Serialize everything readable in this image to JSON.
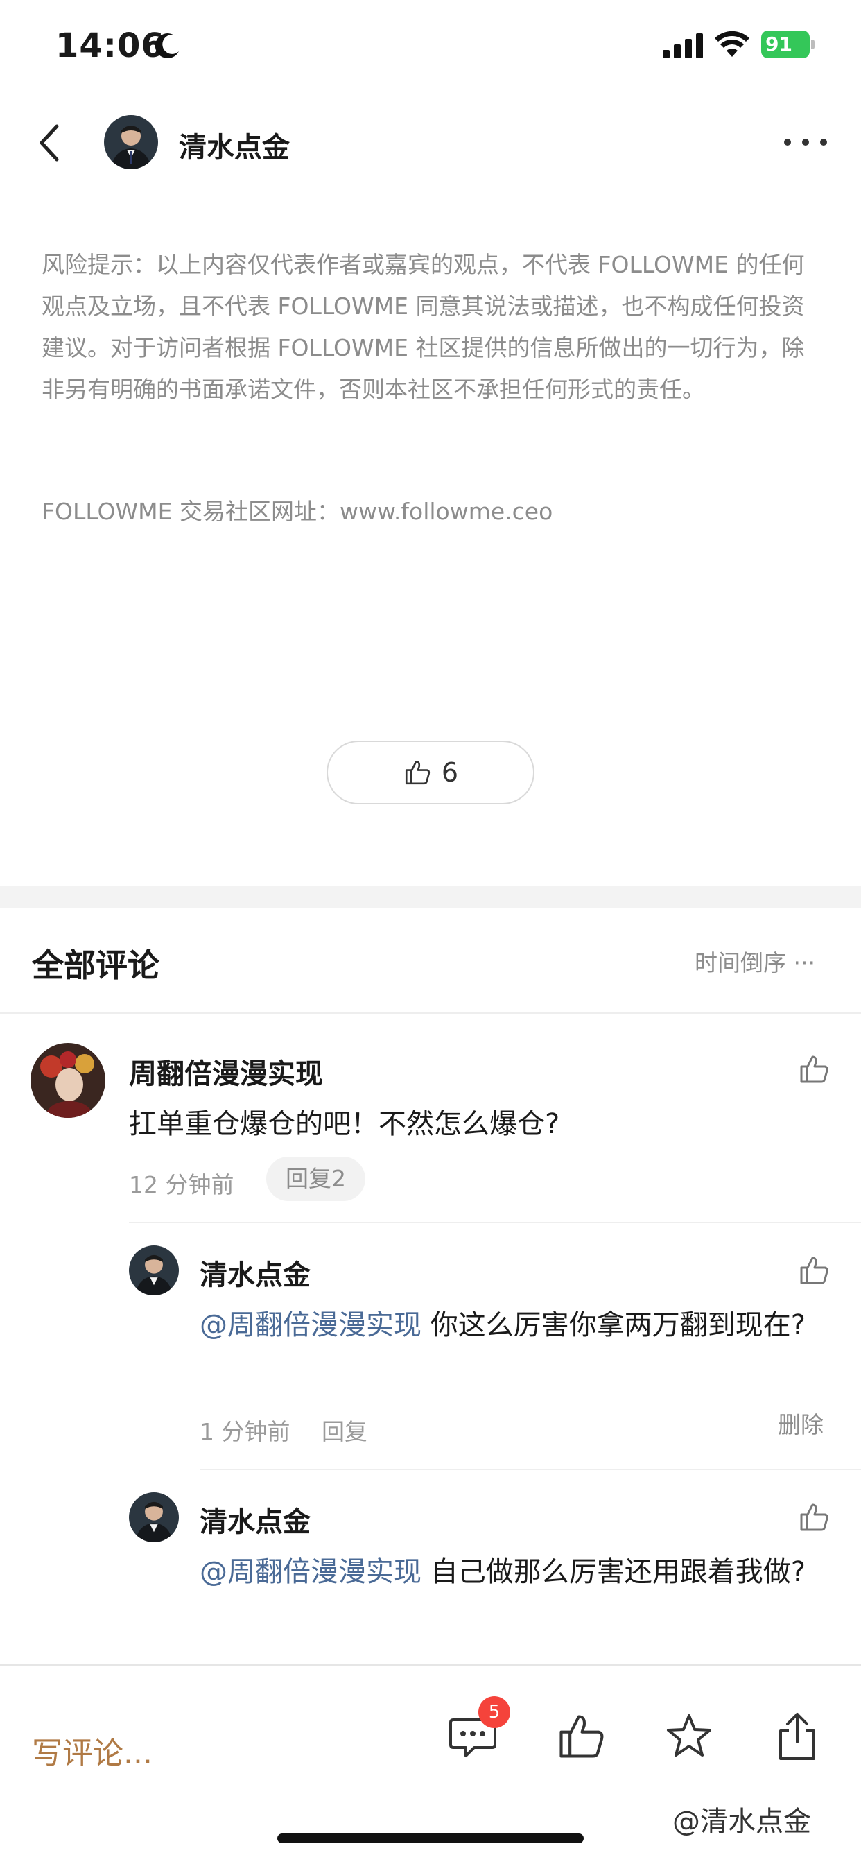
{
  "status_bar": {
    "time": "14:06",
    "battery": "91"
  },
  "nav": {
    "title": "清水点金"
  },
  "disclaimer": {
    "text": "风险提示：以上内容仅代表作者或嘉宾的观点，不代表 FOLLOWME 的任何观点及立场，且不代表 FOLLOWME 同意其说法或描述，也不构成任何投资建议。对于访问者根据 FOLLOWME 社区提供的信息所做出的一切行为，除非另有明确的书面承诺文件，否则本社区不承担任何形式的责任。",
    "site": "FOLLOWME 交易社区网址：www.followme.ceo"
  },
  "like": {
    "count": "6"
  },
  "comments_header": {
    "title": "全部评论",
    "sort": "时间倒序 ···"
  },
  "comment": {
    "author": "周翻倍漫漫实现",
    "text": "扛单重仓爆仓的吧！不然怎么爆仓?",
    "time": "12 分钟前",
    "reply_chip": "回复2"
  },
  "replies": [
    {
      "author": "清水点金",
      "mention": "@周翻倍漫漫实现",
      "text": " 你这么厉害你拿两万翻到现在?",
      "time": "1 分钟前",
      "reply": "回复",
      "delete": "删除"
    },
    {
      "author": "清水点金",
      "mention": "@周翻倍漫漫实现",
      "text": " 自己做那么厉害还用跟着我做?",
      "time": "",
      "reply": "",
      "delete": ""
    }
  ],
  "bottom_bar": {
    "write_placeholder": "写评论...",
    "comment_badge": "5"
  },
  "watermark": "@清水点金",
  "colors": {
    "accent_brown": "#b07a45",
    "mention_blue": "#4a6a96",
    "badge_red": "#f5433b",
    "battery_green": "#34c759"
  }
}
